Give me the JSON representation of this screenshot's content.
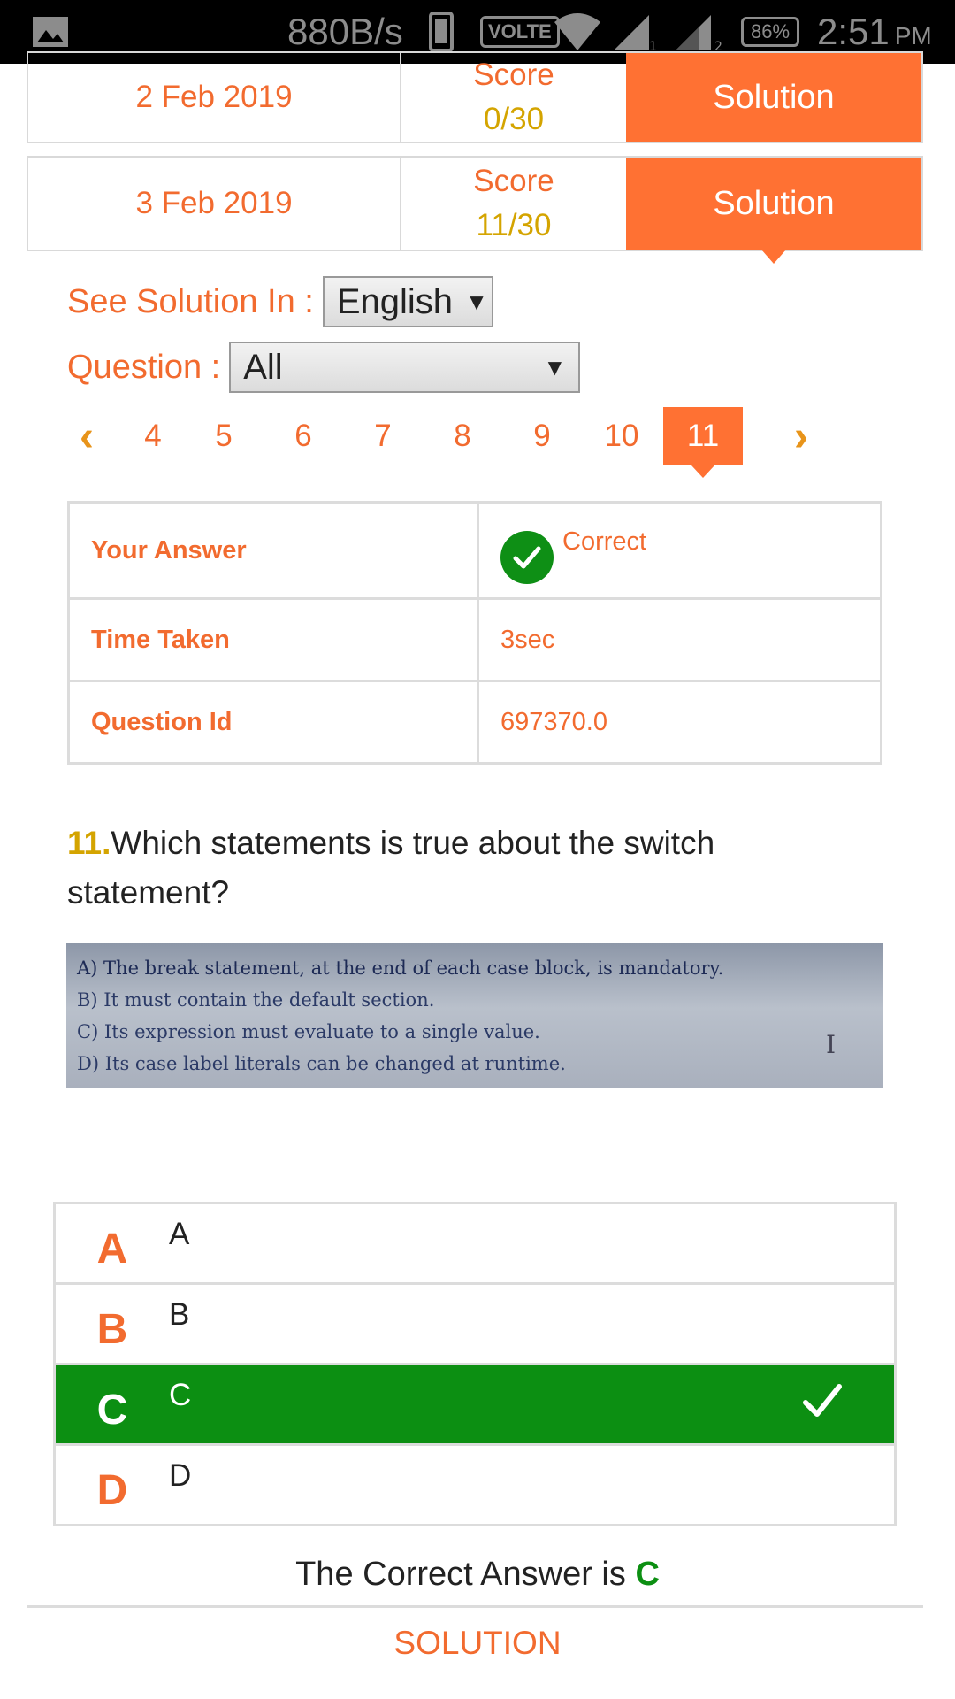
{
  "status_bar": {
    "speed": "880B/s",
    "volte": "VOLTE",
    "sim1": "1",
    "sim2": "2",
    "battery": "86%",
    "time": "2:51",
    "ampm": "PM"
  },
  "attempts": [
    {
      "date": "2 Feb 2019",
      "score_label": "Score",
      "score": "0/30",
      "button": "Solution"
    },
    {
      "date": "3 Feb 2019",
      "score_label": "Score",
      "score": "11/30",
      "button": "Solution"
    }
  ],
  "language": {
    "label": "See Solution In :",
    "selected": "English"
  },
  "question_filter": {
    "label": "Question :",
    "selected": "All"
  },
  "pager": {
    "pages": [
      "4",
      "5",
      "6",
      "7",
      "8",
      "9",
      "10",
      "11"
    ],
    "active": "11"
  },
  "info_table": {
    "your_answer_label": "Your Answer",
    "your_answer_value": "Correct",
    "time_label": "Time Taken",
    "time_value": "3sec",
    "qid_label": "Question Id",
    "qid_value": "697370.0"
  },
  "question": {
    "number": "11.",
    "text": "Which statements is true about the switch statement?",
    "image_lines": [
      "A) The break statement, at the end of each case block, is mandatory.",
      "B) It must contain the default section.",
      "C) Its expression must evaluate to a single value.",
      "D) Its case label literals can be changed at runtime."
    ],
    "image_cursor": "I"
  },
  "options": [
    {
      "letter": "A",
      "text": "A",
      "correct": false
    },
    {
      "letter": "B",
      "text": "B",
      "correct": false
    },
    {
      "letter": "C",
      "text": "C",
      "correct": true
    },
    {
      "letter": "D",
      "text": "D",
      "correct": false
    }
  ],
  "answer": {
    "prefix": "The Correct Answer is",
    "value": "C"
  },
  "solution_link": "SOLUTION",
  "colors": {
    "accent": "#ff7133",
    "text_orange": "#f26b2f",
    "gold": "#d4a400",
    "green": "#0c8f12"
  },
  "icons": [
    "gallery-icon",
    "phone-icon",
    "wifi-icon",
    "signal-icon",
    "battery-icon",
    "chevron-left-icon",
    "chevron-right-icon",
    "check-circle-icon",
    "checkmark-icon",
    "dropdown-arrow-icon"
  ]
}
